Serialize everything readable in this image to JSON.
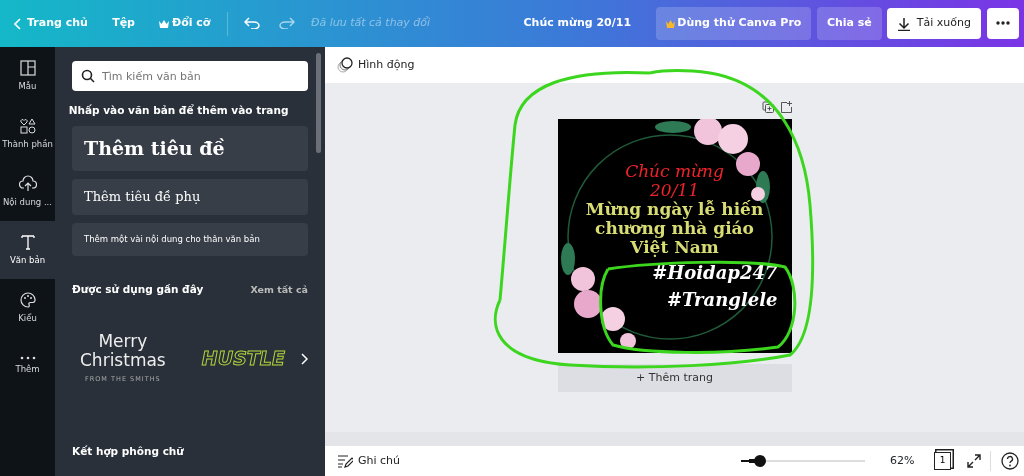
{
  "topbar": {
    "back_label": "Trang chủ",
    "menu": [
      {
        "label": "Tệp",
        "kind": "plain"
      },
      {
        "label": "Đổi cỡ",
        "kind": "crown"
      }
    ],
    "save_status": "Đã lưu tất cả thay đổi",
    "doc_title": "Chúc mừng 20/11",
    "buttons": [
      {
        "label": "Dùng thử Canva Pro",
        "kind": "pro"
      },
      {
        "label": "Chia sẻ",
        "kind": "share"
      },
      {
        "label": "Tải xuống",
        "kind": "download"
      }
    ]
  },
  "sidebar": {
    "items": [
      {
        "label": "Mẫu",
        "selected": false
      },
      {
        "label": "Thành phần",
        "selected": false
      },
      {
        "label": "Nội dung ...",
        "selected": false
      },
      {
        "label": "Văn bản",
        "selected": true
      },
      {
        "label": "Kiểu",
        "selected": false
      },
      {
        "label": "Thêm",
        "selected": false
      }
    ]
  },
  "panel": {
    "search": {
      "placeholder": "Tìm kiếm văn bản"
    },
    "instruction": "Nhấp vào văn bản để thêm vào trang",
    "presets": [
      {
        "label": "Thêm tiêu đề",
        "kind": "heading"
      },
      {
        "label": "Thêm tiêu đề phụ",
        "kind": "subheading"
      },
      {
        "label": "Thêm một vài nội dung cho thân văn bản",
        "kind": "body"
      }
    ],
    "recent": {
      "title": "Được sử dụng gần đây",
      "see_all": "Xem tất cả",
      "items": [
        {
          "kind": "merry",
          "lines": [
            "Merry",
            "Christmas",
            "FROM THE SMITHS"
          ]
        },
        {
          "kind": "hustle",
          "lines": [
            "HUSTLE"
          ]
        }
      ]
    },
    "combos_title": "Kết hợp phông chữ"
  },
  "canvas": {
    "toolbar_label": "Hình động",
    "design": {
      "lines": [
        {
          "text": "Chúc mừng",
          "kind": "greeting"
        },
        {
          "text": "20/11",
          "kind": "greeting"
        },
        {
          "text": "Mừng ngày lễ hiến",
          "kind": "title"
        },
        {
          "text": "chương nhà giáo",
          "kind": "title"
        },
        {
          "text": "Việt Nam",
          "kind": "title"
        },
        {
          "text": "#Hoidap247",
          "kind": "tag"
        },
        {
          "text": "#Tranglele",
          "kind": "tag"
        }
      ]
    },
    "add_page": "+ Thêm trang"
  },
  "bottom": {
    "notes": "Ghi chú",
    "zoom": {
      "level": 0.1,
      "reading": "62%"
    },
    "page_count": "1"
  }
}
